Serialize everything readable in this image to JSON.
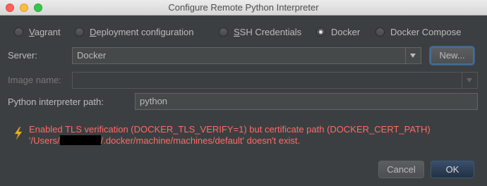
{
  "window": {
    "title": "Configure Remote Python Interpreter"
  },
  "options": [
    {
      "id": "vagrant",
      "pre": "",
      "mnemonic": "V",
      "post": "agrant",
      "checked": false
    },
    {
      "id": "deployment-configuration",
      "pre": "",
      "mnemonic": "D",
      "post": "eployment configuration",
      "checked": false
    },
    {
      "id": "ssh-credentials",
      "pre": "",
      "mnemonic": "S",
      "post": "SH Credentials",
      "checked": false
    },
    {
      "id": "docker",
      "pre": "Docker",
      "mnemonic": "",
      "post": "",
      "checked": true
    },
    {
      "id": "docker-compose",
      "pre": "Docker Compose",
      "mnemonic": "",
      "post": "",
      "checked": false
    }
  ],
  "server": {
    "label": "Server:",
    "value": "Docker",
    "new_button": "New..."
  },
  "image": {
    "label": "Image name:",
    "value": ""
  },
  "interpreter": {
    "label": "Python interpreter path:",
    "value": "python"
  },
  "error": {
    "line1": "Enabled TLS verification (DOCKER_TLS_VERIFY=1) but certificate path (DOCKER_CERT_PATH)",
    "line2_prefix": "'/Users/",
    "line2_suffix": "/.docker/machine/machines/default' doesn't exist.",
    "color": "#ff6b68"
  },
  "buttons": {
    "cancel": "Cancel",
    "ok": "OK"
  },
  "icons": {
    "warning": "lightning-bolt-warning-icon"
  }
}
